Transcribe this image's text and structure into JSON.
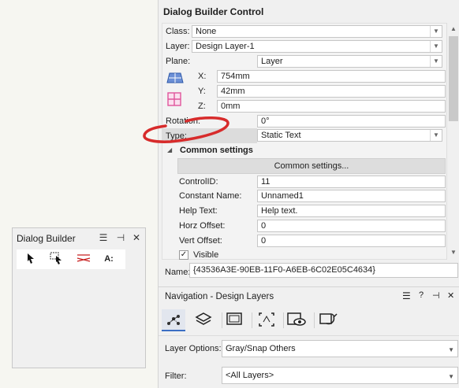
{
  "palette": {
    "title": "Dialog Builder",
    "tools": [
      "pointer-tool",
      "mouse-select-tool",
      "line-tool",
      "text-tool"
    ],
    "text_tool_label": "A:"
  },
  "dbc": {
    "title": "Dialog Builder Control",
    "class_label": "Class:",
    "class_value": "None",
    "layer_label": "Layer:",
    "layer_value": "Design Layer-1",
    "plane_label": "Plane:",
    "plane_value": "Layer",
    "x_label": "X:",
    "x_value": "754mm",
    "y_label": "Y:",
    "y_value": "42mm",
    "z_label": "Z:",
    "z_value": "0mm",
    "rotation_label": "Rotation:",
    "rotation_value": "0°",
    "type_label": "Type:",
    "type_value": "Static Text",
    "common_heading": "Common settings",
    "common_button": "Common settings...",
    "controlid_label": "ControlID:",
    "controlid_value": "11",
    "constname_label": "Constant Name:",
    "constname_value": "Unnamed1",
    "helptext_label": "Help Text:",
    "helptext_value": "Help text.",
    "horz_label": "Horz Offset:",
    "horz_value": "0",
    "vert_label": "Vert Offset:",
    "vert_value": "0",
    "visible_label": "Visible",
    "name_label": "Name:",
    "name_value": "{43536A3E-90EB-11F0-A6EB-6C02E05C4634}"
  },
  "nav": {
    "title": "Navigation - Design Layers",
    "tabs": [
      "connections-icon",
      "layers-icon",
      "sheet-icon",
      "crop-icon",
      "visibility-icon",
      "refresh-icon"
    ],
    "layer_options_label": "Layer Options:",
    "layer_options_value": "Gray/Snap Others",
    "filter_label": "Filter:",
    "filter_value": "<All Layers>"
  },
  "colors": {
    "annotation_red": "#d72b2b",
    "accent_blue": "#3b6fc4"
  }
}
